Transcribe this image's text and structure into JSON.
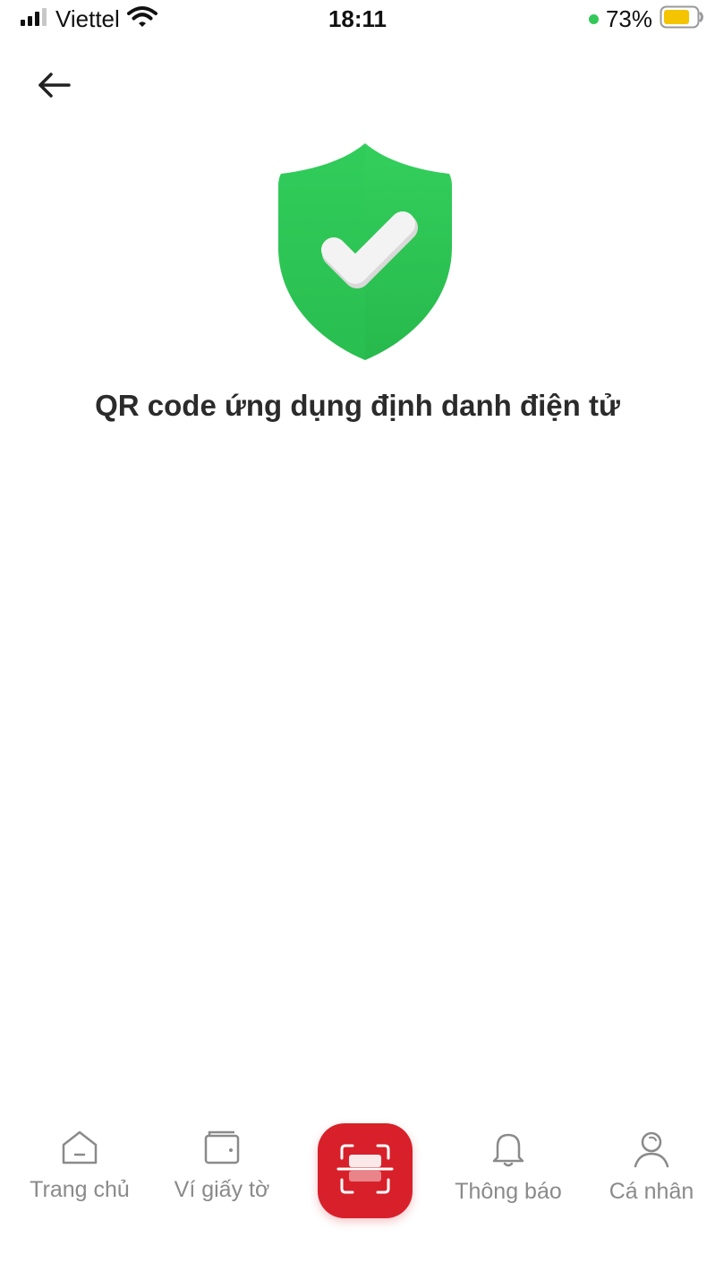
{
  "status_bar": {
    "carrier": "Viettel",
    "time": "18:11",
    "battery_percent": "73%",
    "icons": [
      "signal-icon",
      "wifi-icon",
      "battery-icon"
    ],
    "colors": {
      "dot": "#34c759",
      "battery": "#f5c400"
    }
  },
  "header": {
    "back_icon": "arrow-left-icon"
  },
  "main": {
    "status_icon": "shield-check-icon",
    "title": "QR code ứng dụng định danh điện tử",
    "colors": {
      "shield": "#2cc653",
      "check": "#f3f3f3"
    }
  },
  "bottom_nav": {
    "items": [
      {
        "label": "Trang chủ",
        "icon": "home-icon"
      },
      {
        "label": "Ví giấy tờ",
        "icon": "wallet-icon"
      },
      {
        "label": "Thông báo",
        "icon": "bell-icon"
      },
      {
        "label": "Cá nhân",
        "icon": "user-icon"
      }
    ],
    "scan_icon": "qr-scan-icon",
    "colors": {
      "scan_button": "#d8202a",
      "label": "#8a8a8a"
    }
  }
}
